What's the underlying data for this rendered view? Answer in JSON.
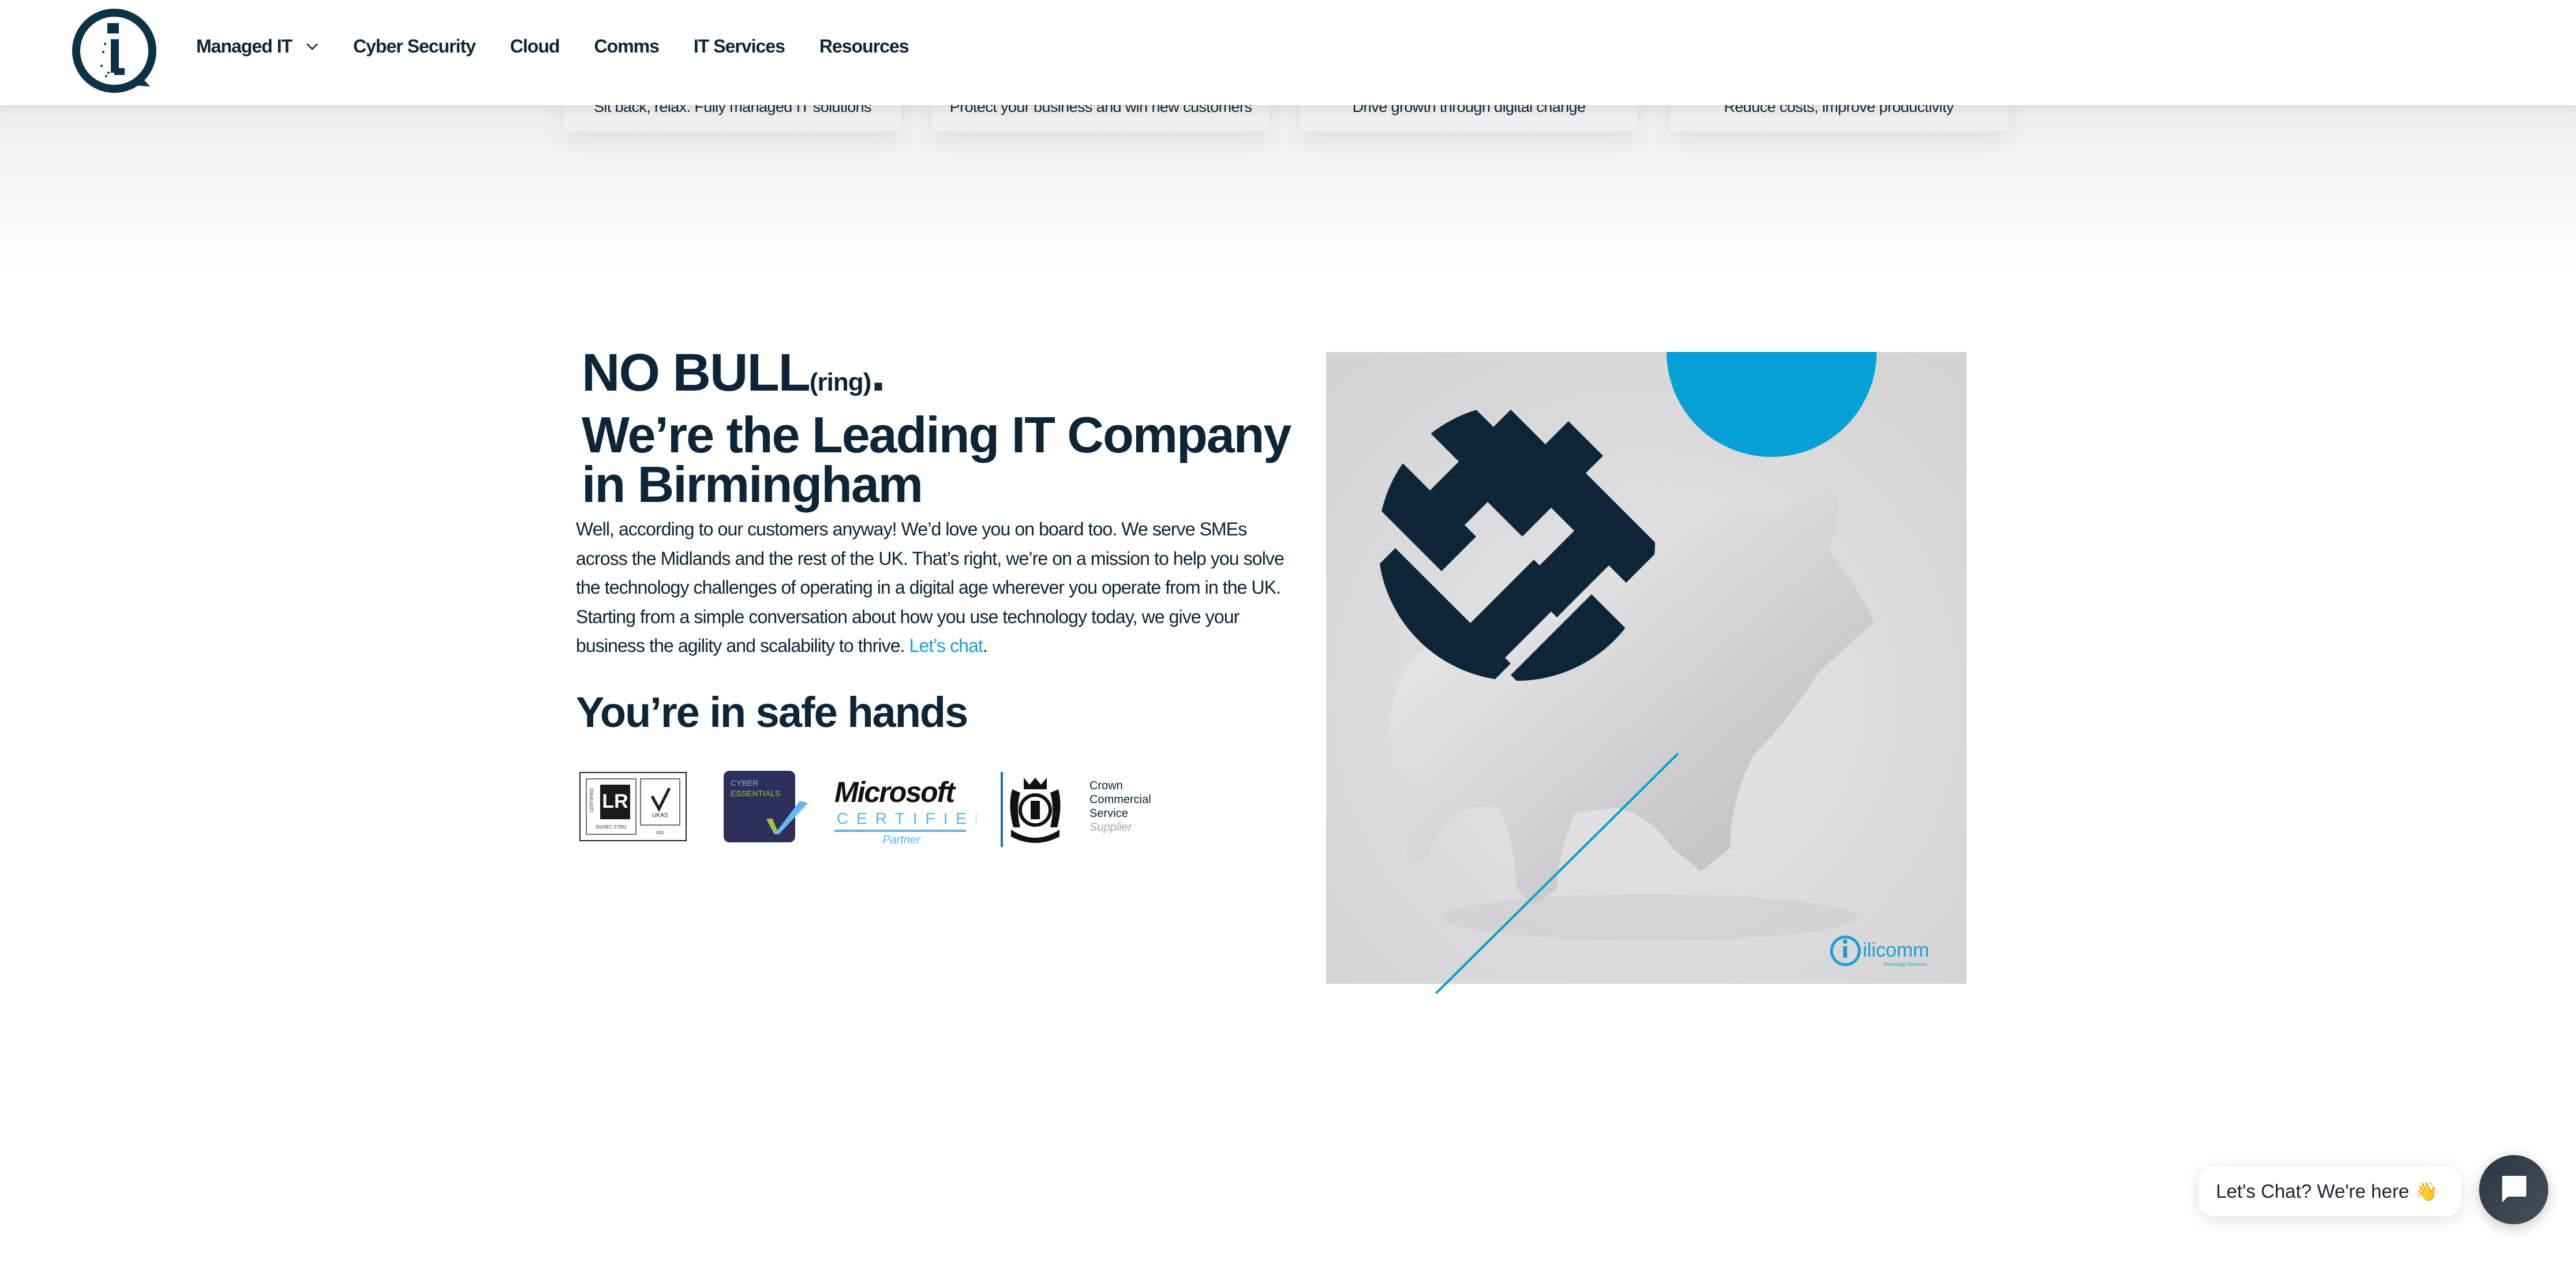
{
  "header": {
    "logo_alt": "ilicomm",
    "nav": [
      {
        "label": "Managed IT",
        "has_dropdown": true
      },
      {
        "label": "Cyber Security",
        "has_dropdown": false
      },
      {
        "label": "Cloud",
        "has_dropdown": false
      },
      {
        "label": "Comms",
        "has_dropdown": false
      },
      {
        "label": "IT Services",
        "has_dropdown": false
      },
      {
        "label": "Resources",
        "has_dropdown": false
      }
    ]
  },
  "cards": [
    {
      "subtitle": "Sit back, relax. Fully managed IT solutions"
    },
    {
      "subtitle": "Protect your business and win new customers"
    },
    {
      "subtitle": "Drive growth through digital change"
    },
    {
      "subtitle": "Reduce costs, improve productivity"
    }
  ],
  "hero": {
    "title_main": "NO BULL",
    "title_small": "(ring)",
    "title_period": ".",
    "title_line2": "We’re the Leading IT Company",
    "title_line3": "in Birmingham",
    "paragraph": "Well, according to our customers anyway! We’d love you on board too. We serve SMEs across the Midlands and the rest of the UK. That’s right, we’re on a mission to help you solve the technology challenges of operating in a digital age wherever you operate from in the UK. Starting from a simple conversation about how you use technology today, we give your business the agility and scalability to thrive.",
    "link_label": "Let’s chat",
    "link_suffix": ".",
    "image_brand": "ilicomm",
    "image_brand_tagline": "Technology Solutions"
  },
  "trust": {
    "heading": "You’re in safe hands",
    "certifications": [
      {
        "name": "LRQA ISO/IEC 27001 UKAS",
        "lines": [
          "CERTIFIED",
          "ISO/IEC 27001",
          "UKAS",
          "001"
        ]
      },
      {
        "name": "Cyber Essentials",
        "lines": [
          "CYBER",
          "ESSENTIALS"
        ]
      },
      {
        "name": "Microsoft Certified Partner",
        "lines": [
          "Microsoft",
          "CERTIFIED",
          "Partner"
        ]
      },
      {
        "name": "Crown Commercial Service Supplier",
        "lines": [
          "Crown",
          "Commercial",
          "Service",
          "Supplier"
        ]
      }
    ]
  },
  "chat": {
    "prompt": "Let's Chat? We're here",
    "wave_emoji": "👋",
    "icon": "chat-icon"
  },
  "colors": {
    "navy": "#0d2536",
    "accent_blue": "#1a9fd6",
    "image_blue": "#05a0d6",
    "chat_button": "#333d4a"
  }
}
